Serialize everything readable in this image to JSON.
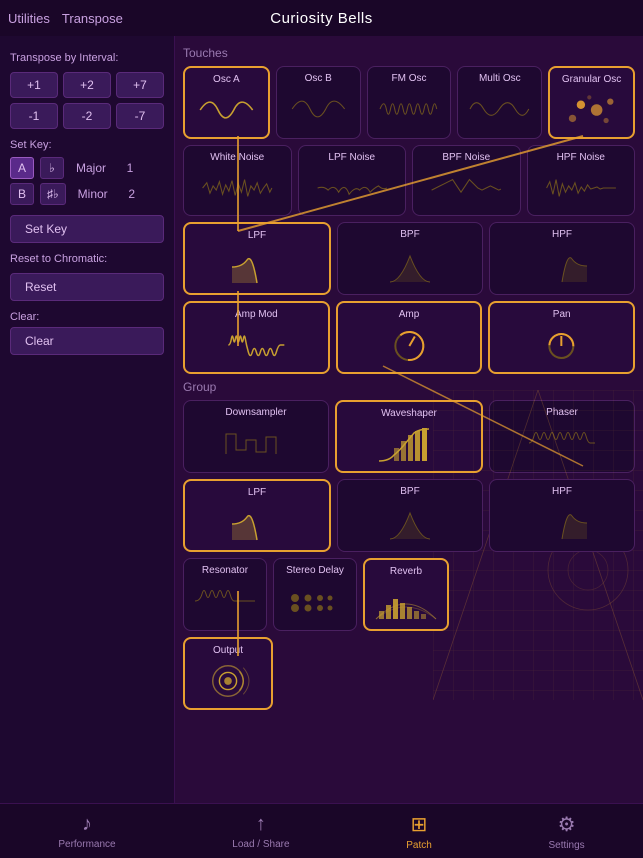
{
  "app": {
    "title": "Curiosity Bells",
    "nav_back": "Utilities",
    "nav_transpose": "Transpose"
  },
  "left_panel": {
    "transpose_label": "Transpose by Interval:",
    "interval_buttons": [
      "+1",
      "+2",
      "+7",
      "-1",
      "-2",
      "-7"
    ],
    "set_key_label": "Set Key:",
    "keys": [
      {
        "note": "A",
        "flat": "♭",
        "type": "Major",
        "num": "1"
      },
      {
        "note": "B",
        "flat": "♯♭",
        "type": "Minor",
        "num": "2"
      }
    ],
    "set_key_btn": "Set Key",
    "reset_label": "Reset to Chromatic:",
    "reset_btn": "Reset",
    "clear_label": "Clear:",
    "clear_btn": "Clear"
  },
  "sections": {
    "touches_label": "Touches",
    "group_label": "Group"
  },
  "touches_modules": [
    {
      "id": "osc-a",
      "label": "Osc A",
      "active": true,
      "shape": "sine"
    },
    {
      "id": "osc-b",
      "label": "Osc B",
      "active": false,
      "shape": "sine_dim"
    },
    {
      "id": "fm-osc",
      "label": "FM Osc",
      "active": false,
      "shape": "multi_sine"
    },
    {
      "id": "multi-osc",
      "label": "Multi Osc",
      "active": false,
      "shape": "multi_sine2"
    },
    {
      "id": "granular-osc",
      "label": "Granular Osc",
      "active": true,
      "shape": "dots"
    }
  ],
  "noise_modules": [
    {
      "id": "white-noise",
      "label": "White Noise",
      "active": false,
      "shape": "noise"
    },
    {
      "id": "lpf-noise",
      "label": "LPF Noise",
      "active": false,
      "shape": "noise2"
    },
    {
      "id": "bpf-noise",
      "label": "BPF Noise",
      "active": false,
      "shape": "noise3"
    },
    {
      "id": "hpf-noise",
      "label": "HPF Noise",
      "active": false,
      "shape": "noise4"
    }
  ],
  "filter_modules": [
    {
      "id": "lpf",
      "label": "LPF",
      "active": true,
      "shape": "lpf"
    },
    {
      "id": "bpf",
      "label": "BPF",
      "active": false,
      "shape": "bpf"
    },
    {
      "id": "hpf",
      "label": "HPF",
      "active": false,
      "shape": "hpf"
    }
  ],
  "amp_modules": [
    {
      "id": "amp-mod",
      "label": "Amp Mod",
      "active": true,
      "shape": "ampmod"
    },
    {
      "id": "amp",
      "label": "Amp",
      "active": true,
      "shape": "amp"
    },
    {
      "id": "pan",
      "label": "Pan",
      "active": true,
      "shape": "pan"
    }
  ],
  "group_modules": [
    {
      "id": "downsampler",
      "label": "Downsampler",
      "active": false,
      "shape": "downsampler"
    },
    {
      "id": "waveshaper",
      "label": "Waveshaper",
      "active": true,
      "shape": "waveshaper"
    },
    {
      "id": "phaser",
      "label": "Phaser",
      "active": false,
      "shape": "phaser"
    }
  ],
  "group_filter_modules": [
    {
      "id": "g-lpf",
      "label": "LPF",
      "active": true,
      "shape": "lpf"
    },
    {
      "id": "g-bpf",
      "label": "BPF",
      "active": false,
      "shape": "bpf"
    },
    {
      "id": "g-hpf",
      "label": "HPF",
      "active": false,
      "shape": "hpf"
    }
  ],
  "effect_modules": [
    {
      "id": "resonator",
      "label": "Resonator",
      "active": false,
      "shape": "resonator"
    },
    {
      "id": "stereo-delay",
      "label": "Stereo Delay",
      "active": false,
      "shape": "stereo_delay"
    },
    {
      "id": "reverb",
      "label": "Reverb",
      "active": true,
      "shape": "reverb"
    }
  ],
  "output_module": {
    "id": "output",
    "label": "Output",
    "active": true,
    "shape": "speaker"
  },
  "bottom_nav": [
    {
      "id": "performance",
      "label": "Performance",
      "icon": "🎵",
      "active": false
    },
    {
      "id": "load-share",
      "label": "Load / Share",
      "icon": "⬆",
      "active": false
    },
    {
      "id": "patch",
      "label": "Patch",
      "icon": "⊞",
      "active": true
    },
    {
      "id": "settings",
      "label": "Settings",
      "icon": "⚙",
      "active": false
    }
  ]
}
